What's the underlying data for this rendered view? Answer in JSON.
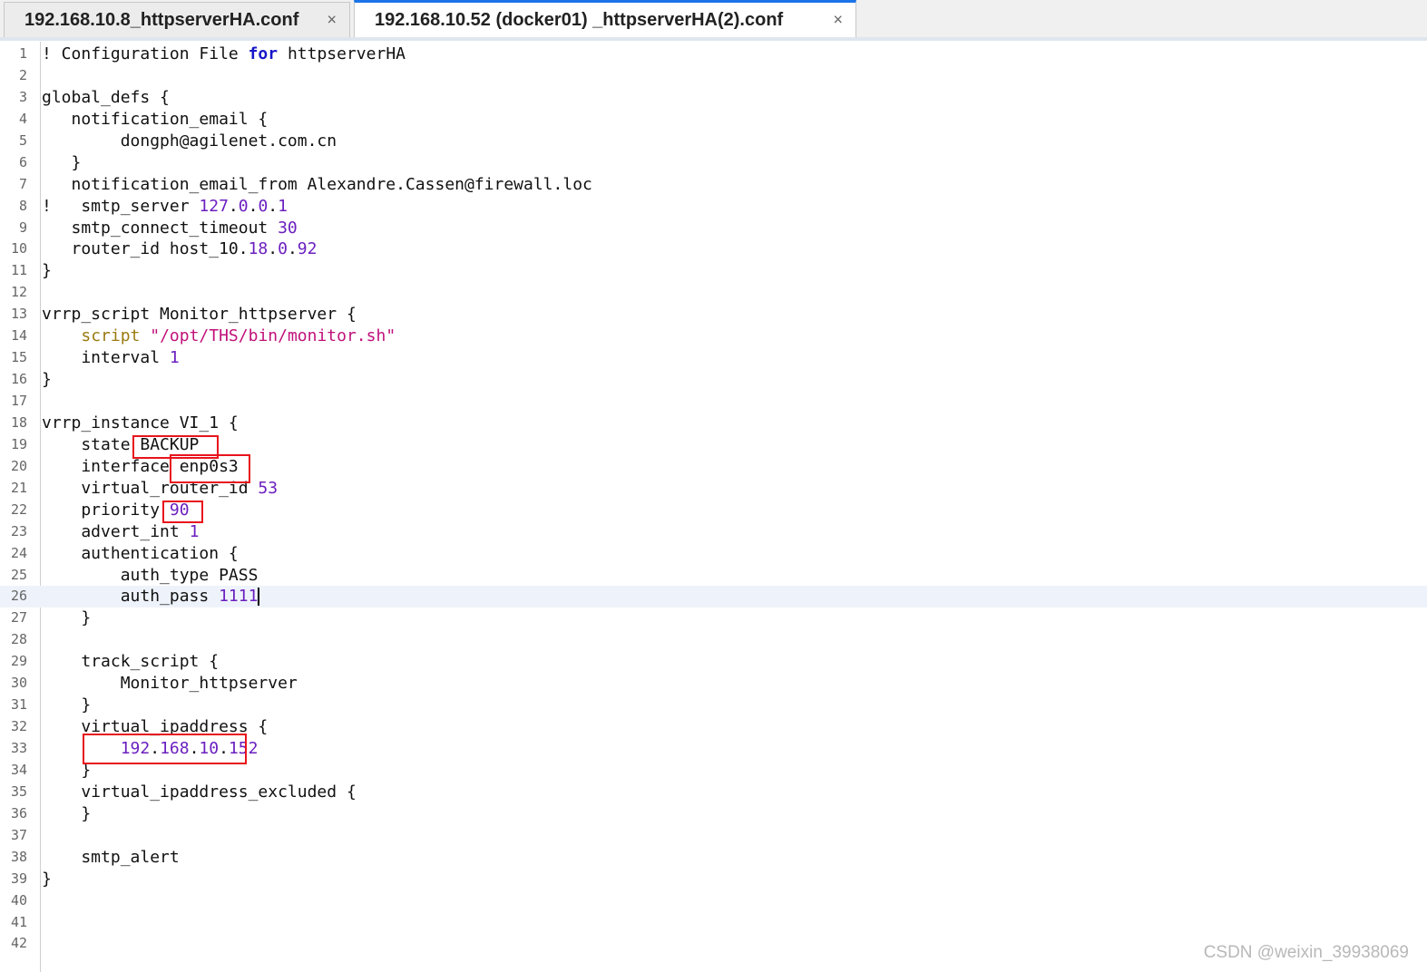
{
  "tabs": [
    {
      "label": "192.168.10.8_httpserverHA.conf",
      "close": "×",
      "active": false
    },
    {
      "label": "192.168.10.52  (docker01)  _httpserverHA(2).conf",
      "close": "×",
      "active": true
    }
  ],
  "editor": {
    "current_line": 26,
    "lines": [
      {
        "n": "1",
        "parts": [
          [
            "!",
            ""
          ],
          [
            " Configuration File ",
            ""
          ],
          [
            "for",
            "kw"
          ],
          [
            " httpserverHA",
            ""
          ]
        ]
      },
      {
        "n": "2",
        "parts": []
      },
      {
        "n": "3",
        "parts": [
          [
            "global_defs {",
            ""
          ]
        ]
      },
      {
        "n": "4",
        "parts": [
          [
            "   notification_email {",
            ""
          ]
        ]
      },
      {
        "n": "5",
        "parts": [
          [
            "        dongph@agilenet.com.cn",
            ""
          ]
        ]
      },
      {
        "n": "6",
        "parts": [
          [
            "   }",
            ""
          ]
        ]
      },
      {
        "n": "7",
        "parts": [
          [
            "   notification_email_from Alexandre.Cassen@firewall.loc",
            ""
          ]
        ]
      },
      {
        "n": "8",
        "parts": [
          [
            "!   smtp_server ",
            ""
          ],
          [
            "127",
            "num"
          ],
          [
            ".",
            ""
          ],
          [
            "0",
            "num"
          ],
          [
            ".",
            ""
          ],
          [
            "0",
            "num"
          ],
          [
            ".",
            ""
          ],
          [
            "1",
            "num"
          ]
        ]
      },
      {
        "n": "9",
        "parts": [
          [
            "   smtp_connect_timeout ",
            ""
          ],
          [
            "30",
            "num"
          ]
        ]
      },
      {
        "n": "10",
        "parts": [
          [
            "   router_id host_10.",
            ""
          ],
          [
            "18",
            "num"
          ],
          [
            ".",
            ""
          ],
          [
            "0",
            "num"
          ],
          [
            ".",
            ""
          ],
          [
            "92",
            "num"
          ]
        ]
      },
      {
        "n": "11",
        "parts": [
          [
            "}",
            ""
          ]
        ]
      },
      {
        "n": "12",
        "parts": []
      },
      {
        "n": "13",
        "parts": [
          [
            "vrrp_script Monitor_httpserver {",
            ""
          ]
        ]
      },
      {
        "n": "14",
        "parts": [
          [
            "    ",
            ""
          ],
          [
            "script",
            "fn"
          ],
          [
            " ",
            ""
          ],
          [
            "\"/opt/THS/bin/monitor.sh\"",
            "str"
          ]
        ]
      },
      {
        "n": "15",
        "parts": [
          [
            "    interval ",
            ""
          ],
          [
            "1",
            "num"
          ]
        ]
      },
      {
        "n": "16",
        "parts": [
          [
            "}",
            ""
          ]
        ]
      },
      {
        "n": "17",
        "parts": []
      },
      {
        "n": "18",
        "parts": [
          [
            "vrrp_instance VI_1 {",
            ""
          ]
        ]
      },
      {
        "n": "19",
        "parts": [
          [
            "    state BACKUP",
            ""
          ]
        ]
      },
      {
        "n": "20",
        "parts": [
          [
            "    interface enp0s3",
            ""
          ]
        ]
      },
      {
        "n": "21",
        "parts": [
          [
            "    virtual_router_id ",
            ""
          ],
          [
            "53",
            "num"
          ]
        ]
      },
      {
        "n": "22",
        "parts": [
          [
            "    priority ",
            ""
          ],
          [
            "90",
            "num"
          ]
        ]
      },
      {
        "n": "23",
        "parts": [
          [
            "    advert_int ",
            ""
          ],
          [
            "1",
            "num"
          ]
        ]
      },
      {
        "n": "24",
        "parts": [
          [
            "    authentication {",
            ""
          ]
        ]
      },
      {
        "n": "25",
        "parts": [
          [
            "        auth_type PASS",
            ""
          ]
        ]
      },
      {
        "n": "26",
        "parts": [
          [
            "        auth_pass ",
            ""
          ],
          [
            "1111",
            "num"
          ]
        ]
      },
      {
        "n": "27",
        "parts": [
          [
            "    }",
            ""
          ]
        ]
      },
      {
        "n": "28",
        "parts": []
      },
      {
        "n": "29",
        "parts": [
          [
            "    track_script {",
            ""
          ]
        ]
      },
      {
        "n": "30",
        "parts": [
          [
            "        Monitor_httpserver",
            ""
          ]
        ]
      },
      {
        "n": "31",
        "parts": [
          [
            "    }",
            ""
          ]
        ]
      },
      {
        "n": "32",
        "parts": [
          [
            "    virtual_ipaddress {",
            ""
          ]
        ]
      },
      {
        "n": "33",
        "parts": [
          [
            "        ",
            ""
          ],
          [
            "192",
            "num"
          ],
          [
            ".",
            ""
          ],
          [
            "168",
            "num"
          ],
          [
            ".",
            ""
          ],
          [
            "10",
            "num"
          ],
          [
            ".",
            ""
          ],
          [
            "152",
            "num"
          ]
        ]
      },
      {
        "n": "34",
        "parts": [
          [
            "    }",
            ""
          ]
        ]
      },
      {
        "n": "35",
        "parts": [
          [
            "    virtual_ipaddress_excluded {",
            ""
          ]
        ]
      },
      {
        "n": "36",
        "parts": [
          [
            "    }",
            ""
          ]
        ]
      },
      {
        "n": "37",
        "parts": []
      },
      {
        "n": "38",
        "parts": [
          [
            "    smtp_alert",
            ""
          ]
        ]
      },
      {
        "n": "39",
        "parts": [
          [
            "}",
            ""
          ]
        ]
      },
      {
        "n": "40",
        "parts": []
      },
      {
        "n": "41",
        "parts": []
      },
      {
        "n": "42",
        "parts": []
      }
    ]
  },
  "annotations": {
    "color": "#e8141c",
    "boxes": [
      "state-value",
      "interface-value",
      "priority-value",
      "virtual-ip-value"
    ]
  },
  "watermark": "CSDN @weixin_39938069"
}
